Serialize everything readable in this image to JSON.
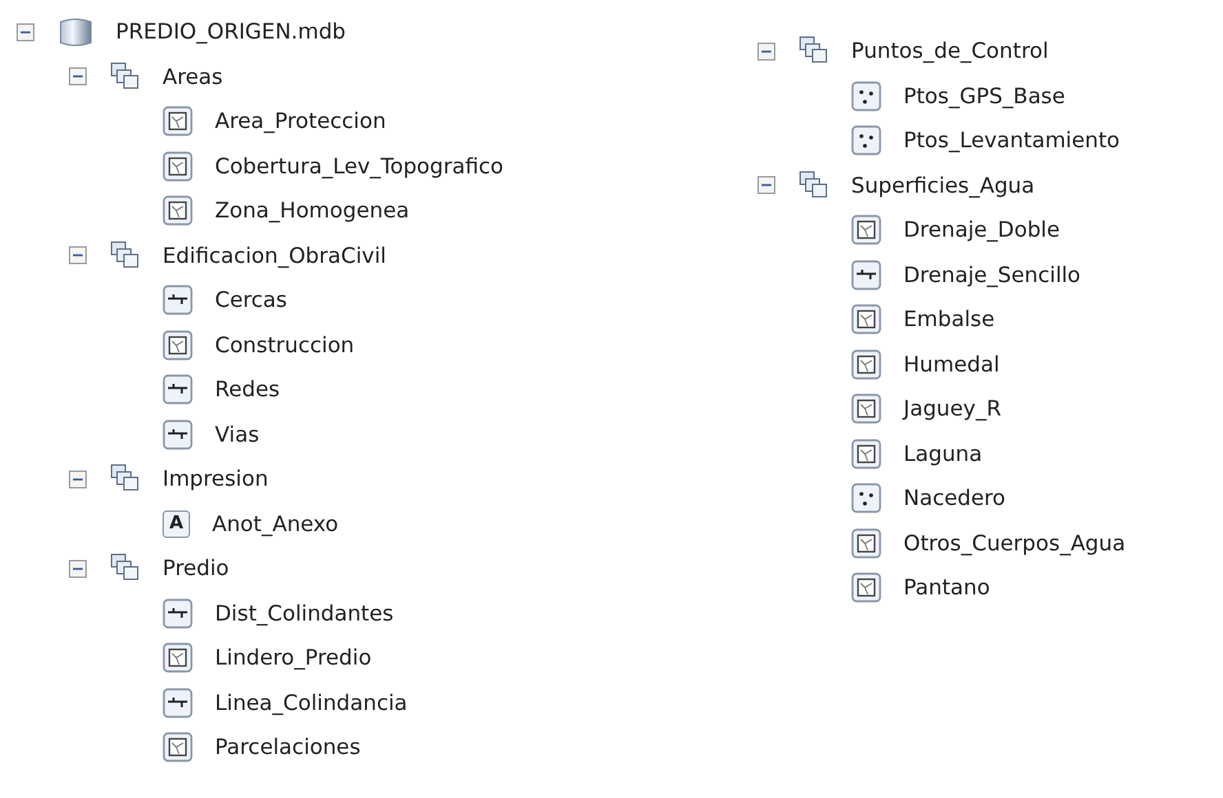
{
  "tree": {
    "label": "PREDIO_ORIGEN.mdb",
    "kind": "database",
    "expanded": true,
    "columns": [
      {
        "children": [
          {
            "label": "Areas",
            "kind": "dataset",
            "expanded": true,
            "children": [
              {
                "label": "Area_Proteccion",
                "kind": "polygon"
              },
              {
                "label": "Cobertura_Lev_Topografico",
                "kind": "polygon"
              },
              {
                "label": "Zona_Homogenea",
                "kind": "polygon"
              }
            ]
          },
          {
            "label": "Edificacion_ObraCivil",
            "kind": "dataset",
            "expanded": true,
            "children": [
              {
                "label": "Cercas",
                "kind": "line"
              },
              {
                "label": "Construccion",
                "kind": "polygon"
              },
              {
                "label": "Redes",
                "kind": "line"
              },
              {
                "label": "Vias",
                "kind": "line"
              }
            ]
          },
          {
            "label": "Impresion",
            "kind": "dataset",
            "expanded": true,
            "children": [
              {
                "label": "Anot_Anexo",
                "kind": "annotation",
                "icon_text": "A"
              }
            ]
          },
          {
            "label": "Predio",
            "kind": "dataset",
            "expanded": true,
            "children": [
              {
                "label": "Dist_Colindantes",
                "kind": "line"
              },
              {
                "label": "Lindero_Predio",
                "kind": "polygon"
              },
              {
                "label": "Linea_Colindancia",
                "kind": "line"
              },
              {
                "label": "Parcelaciones",
                "kind": "polygon"
              }
            ]
          }
        ]
      },
      {
        "children": [
          {
            "label": "Puntos_de_Control",
            "kind": "dataset",
            "expanded": true,
            "children": [
              {
                "label": "Ptos_GPS_Base",
                "kind": "point"
              },
              {
                "label": "Ptos_Levantamiento",
                "kind": "point"
              }
            ]
          },
          {
            "label": "Superficies_Agua",
            "kind": "dataset",
            "expanded": true,
            "children": [
              {
                "label": "Drenaje_Doble",
                "kind": "polygon"
              },
              {
                "label": "Drenaje_Sencillo",
                "kind": "line"
              },
              {
                "label": "Embalse",
                "kind": "polygon"
              },
              {
                "label": "Humedal",
                "kind": "polygon"
              },
              {
                "label": "Jaguey_R",
                "kind": "polygon"
              },
              {
                "label": "Laguna",
                "kind": "polygon"
              },
              {
                "label": "Nacedero",
                "kind": "point"
              },
              {
                "label": "Otros_Cuerpos_Agua",
                "kind": "polygon"
              },
              {
                "label": "Pantano",
                "kind": "polygon"
              }
            ]
          }
        ]
      }
    ]
  }
}
